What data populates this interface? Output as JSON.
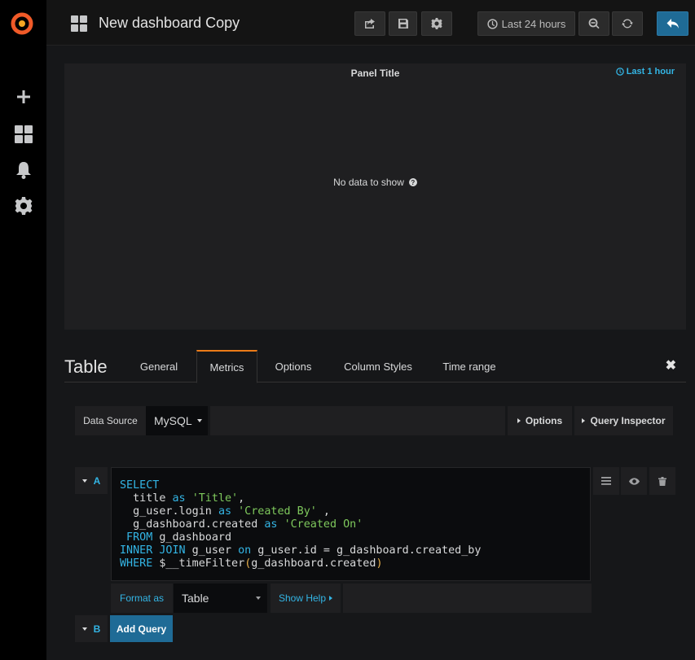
{
  "topbar": {
    "dashboard_title": "New dashboard Copy",
    "time_range_label": "Last 24 hours"
  },
  "panel": {
    "title": "Panel Title",
    "time_override": "Last 1 hour",
    "no_data": "No data to show"
  },
  "editor": {
    "title": "Table",
    "tabs": [
      "General",
      "Metrics",
      "Options",
      "Column Styles",
      "Time range"
    ],
    "active_tab": "Metrics",
    "close_symbol": "✖"
  },
  "datasource": {
    "label": "Data Source",
    "value": "MySQL",
    "options_label": "Options",
    "inspector_label": "Query Inspector"
  },
  "queries": {
    "a_letter": "A",
    "b_letter": "B",
    "sql": {
      "l1_kw": "SELECT",
      "l2_pre": "  title ",
      "l2_kw": "as",
      "l2_str": "'Title'",
      "l2_post": ",",
      "l3_pre": "  g_user.login ",
      "l3_kw": "as",
      "l3_str": "'Created By'",
      "l3_post": " ,",
      "l4_pre": "  g_dashboard.created ",
      "l4_kw": "as",
      "l4_str": "'Created On'",
      "l5_kw": " FROM",
      "l5_post": " g_dashboard",
      "l6_kw": "INNER JOIN",
      "l6_mid": " g_user ",
      "l6_kw2": "on",
      "l6_post": " g_user.id = g_dashboard.created_by",
      "l7_kw": "WHERE",
      "l7_mid": " $__timeFilter",
      "l7_paren1": "(",
      "l7_arg": "g_dashboard.created",
      "l7_paren2": ")"
    },
    "format_label": "Format as",
    "format_value": "Table",
    "show_help_label": "Show Help",
    "add_query_label": "Add Query"
  },
  "colors": {
    "accent_blue": "#33b5e5",
    "primary_button": "#1f6b96",
    "active_tab_border": "#eb7b18"
  }
}
